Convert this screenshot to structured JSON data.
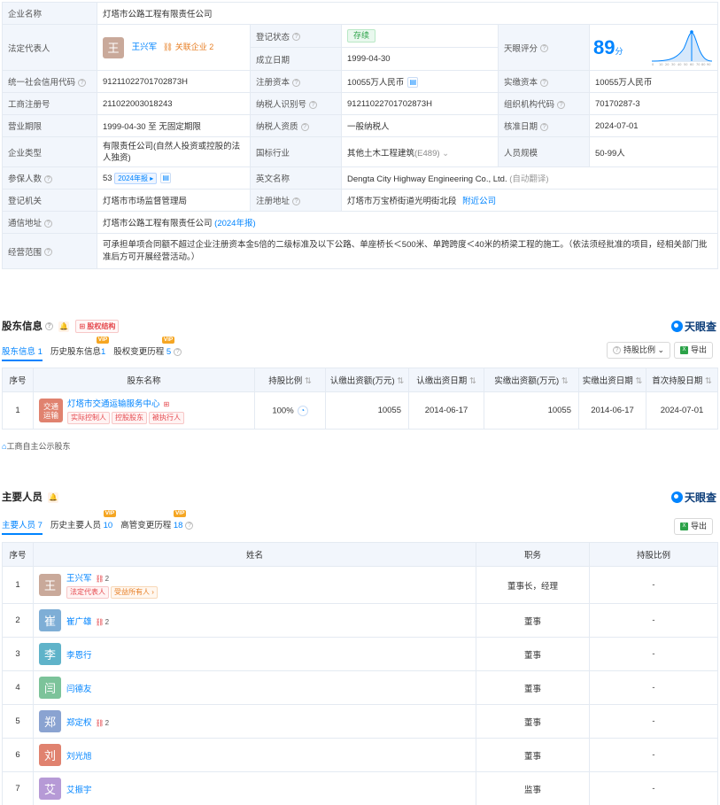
{
  "info": {
    "company_name_label": "企业名称",
    "company_name": "灯塔市公路工程有限责任公司",
    "legal_rep_label": "法定代表人",
    "legal_rep_avatar": "王",
    "legal_rep_name": "王兴军",
    "legal_rep_corp_label": "关联企业",
    "legal_rep_corp_count": "2",
    "reg_status_label": "登记状态",
    "reg_status": "存续",
    "established_label": "成立日期",
    "established": "1999-04-30",
    "tianyan_score_label": "天眼评分",
    "tianyan_score": "89",
    "tianyan_score_unit": "分",
    "credit_code_label": "统一社会信用代码",
    "credit_code": "91211022701702873H",
    "reg_capital_label": "注册资本",
    "reg_capital": "10055万人民币",
    "paid_capital_label": "实缴资本",
    "paid_capital": "10055万人民币",
    "biz_reg_no_label": "工商注册号",
    "biz_reg_no": "211022003018243",
    "taxpayer_id_label": "纳税人识别号",
    "taxpayer_id": "91211022701702873H",
    "org_code_label": "组织机构代码",
    "org_code": "70170287-3",
    "term_label": "营业期限",
    "term": "1999-04-30 至 无固定期限",
    "taxpayer_qual_label": "纳税人资质",
    "taxpayer_qual": "一般纳税人",
    "approval_date_label": "核准日期",
    "approval_date": "2024-07-01",
    "company_type_label": "企业类型",
    "company_type": "有限责任公司(自然人投资或控股的法人独资)",
    "industry_label": "国标行业",
    "industry": "其他土木工程建筑",
    "industry_code": "(E489)",
    "staff_size_label": "人员规模",
    "staff_size": "50-99人",
    "insured_label": "参保人数",
    "insured": "53",
    "insured_report": "2024年报",
    "english_name_label": "英文名称",
    "english_name": "Dengta City Highway Engineering Co., Ltd.",
    "english_name_note": "(自动翻译)",
    "authority_label": "登记机关",
    "authority": "灯塔市市场监督管理局",
    "address_label": "注册地址",
    "address": "灯塔市万宝桥街道光明街北段",
    "nearby": "附近公司",
    "mail_address_label": "通信地址",
    "mail_address": "灯塔市公路工程有限责任公司",
    "mail_address_report": "(2024年报)",
    "scope_label": "经营范围",
    "scope": "可承担单项合同额不超过企业注册资本金5倍的二级标准及以下公路、单座桥长＜500米、单跨跨度＜40米的桥梁工程的施工。（依法须经批准的项目，经相关部门批准后方可开展经营活动。）"
  },
  "shareholders": {
    "title": "股东信息",
    "equity_btn": "股权结构",
    "logo": "天眼查",
    "tabs": [
      {
        "label": "股东信息",
        "count": "1",
        "vip": false
      },
      {
        "label": "历史股东信息",
        "count": "1",
        "vip": true
      },
      {
        "label": "股权变更历程",
        "count": "5",
        "vip": true
      }
    ],
    "vip_label": "VIP",
    "ratio_btn": "持股比例",
    "export_btn": "导出",
    "columns": [
      "序号",
      "股东名称",
      "持股比例",
      "认缴出资额(万元)",
      "认缴出资日期",
      "实缴出资额(万元)",
      "实缴出资日期",
      "首次持股日期"
    ],
    "rows": [
      {
        "index": "1",
        "avatar": "交通运输",
        "name": "灯塔市交通运输服务中心",
        "tags": [
          "实际控制人",
          "控股股东",
          "被执行人"
        ],
        "ratio": "100%",
        "subscribed": "10055",
        "subscribed_date": "2014-06-17",
        "paid": "10055",
        "paid_date": "2014-06-17",
        "first_date": "2024-07-01"
      }
    ],
    "footnote": "工商自主公示股东"
  },
  "staff": {
    "title": "主要人员",
    "logo": "天眼查",
    "tabs": [
      {
        "label": "主要人员",
        "count": "7",
        "vip": false
      },
      {
        "label": "历史主要人员",
        "count": "10",
        "vip": true
      },
      {
        "label": "高管变更历程",
        "count": "18",
        "vip": true
      }
    ],
    "export_btn": "导出",
    "columns": [
      "序号",
      "姓名",
      "职务",
      "持股比例"
    ],
    "rows": [
      {
        "index": "1",
        "avatar": "王",
        "color": "#c9a99a",
        "name": "王兴军",
        "corp": "2",
        "tags": [
          "法定代表人",
          "受益所有人"
        ],
        "title": "董事长，经理",
        "ratio": "-"
      },
      {
        "index": "2",
        "avatar": "崔",
        "color": "#7eaed6",
        "name": "崔广雄",
        "corp": "2",
        "tags": [],
        "title": "董事",
        "ratio": "-"
      },
      {
        "index": "3",
        "avatar": "李",
        "color": "#5fb3c9",
        "name": "李恩行",
        "corp": "",
        "tags": [],
        "title": "董事",
        "ratio": "-"
      },
      {
        "index": "4",
        "avatar": "闫",
        "color": "#7cc39a",
        "name": "闫德友",
        "corp": "",
        "tags": [],
        "title": "董事",
        "ratio": "-"
      },
      {
        "index": "5",
        "avatar": "郑",
        "color": "#8aa3d1",
        "name": "郑定权",
        "corp": "2",
        "tags": [],
        "title": "董事",
        "ratio": "-"
      },
      {
        "index": "6",
        "avatar": "刘",
        "color": "#e0826f",
        "name": "刘光旭",
        "corp": "",
        "tags": [],
        "title": "董事",
        "ratio": "-"
      },
      {
        "index": "7",
        "avatar": "艾",
        "color": "#b69ad6",
        "name": "艾振宇",
        "corp": "",
        "tags": [],
        "title": "监事",
        "ratio": "-"
      }
    ]
  },
  "colors": {
    "accent": "#0084ff",
    "label_bg": "#f2f6fc",
    "vip": "#f5a623",
    "status_green": "#2ba248"
  }
}
